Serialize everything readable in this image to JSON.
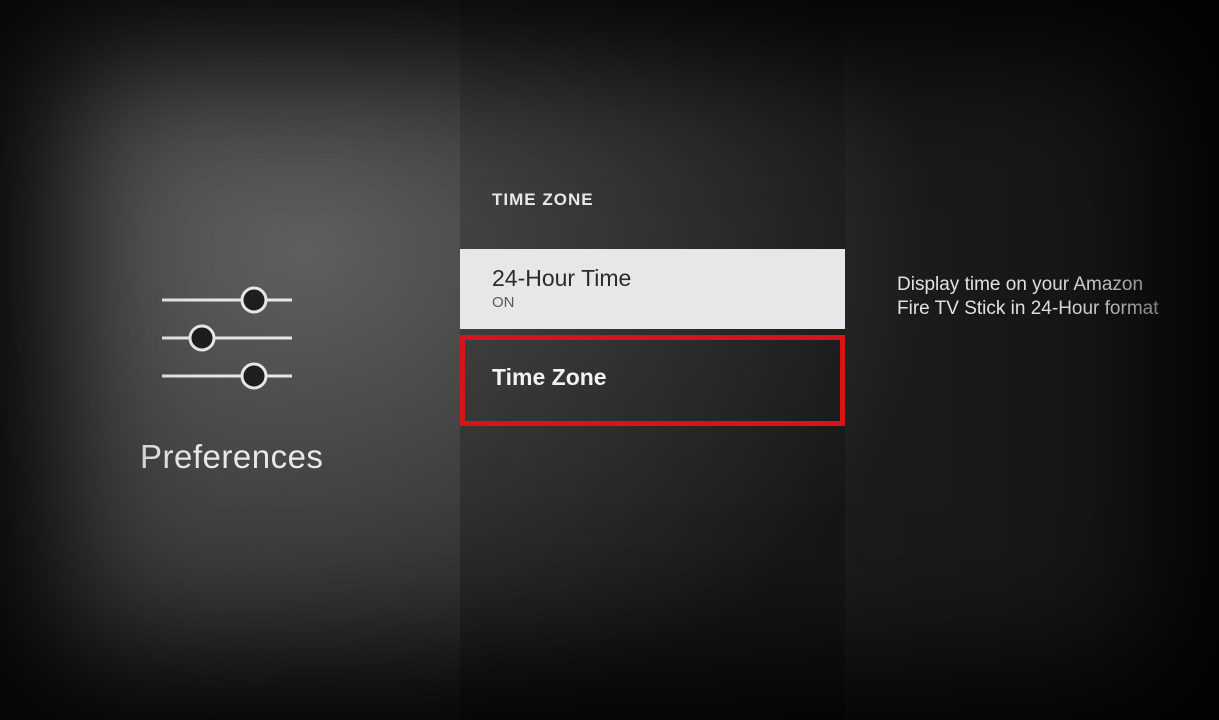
{
  "left": {
    "title": "Preferences"
  },
  "section_header": "TIME ZONE",
  "items": [
    {
      "title": "24-Hour Time",
      "sub": "ON"
    },
    {
      "title": "Time Zone"
    }
  ],
  "description": "Display time on your Amazon Fire TV Stick in 24-Hour format"
}
